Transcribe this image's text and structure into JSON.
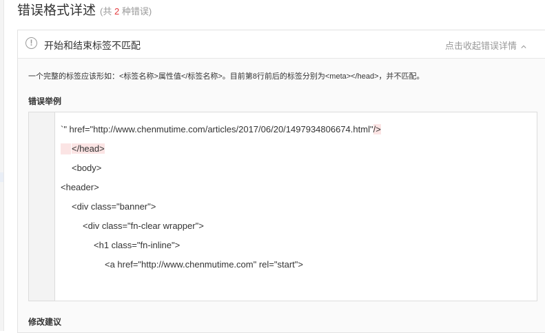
{
  "page": {
    "title": "错误格式详述",
    "count_prefix": "(共",
    "count": "2",
    "count_suffix": "种错误)"
  },
  "error": {
    "icon": "exclamation-circle-icon",
    "title": "开始和结束标签不匹配",
    "collapse_label": "点击收起错误详情",
    "description": "一个完整的标签应该形如：<标签名称>属性值</标签名称>。目前第8行前后的标签分别为<meta></head>，并不匹配。",
    "example_label": "错误举例",
    "fix_label": "修改建议",
    "code_lines": [
      {
        "text": "`\" href=\"http://www.chenmutime.com/articles/2017/06/20/1497934806674.html\"",
        "tail": "/>"
      },
      {
        "text": "</head>"
      },
      {
        "text": "<body>"
      },
      {
        "text": "<header>"
      },
      {
        "text": "<div class=\"banner\">"
      },
      {
        "text": "<div class=\"fn-clear wrapper\">"
      },
      {
        "text": "<h1 class=\"fn-inline\">"
      },
      {
        "text": "<a href=\"http://www.chenmutime.com\" rel=\"start\">"
      }
    ]
  },
  "colors": {
    "accent_red": "#e4393c",
    "highlight": "#fbe4e4"
  }
}
